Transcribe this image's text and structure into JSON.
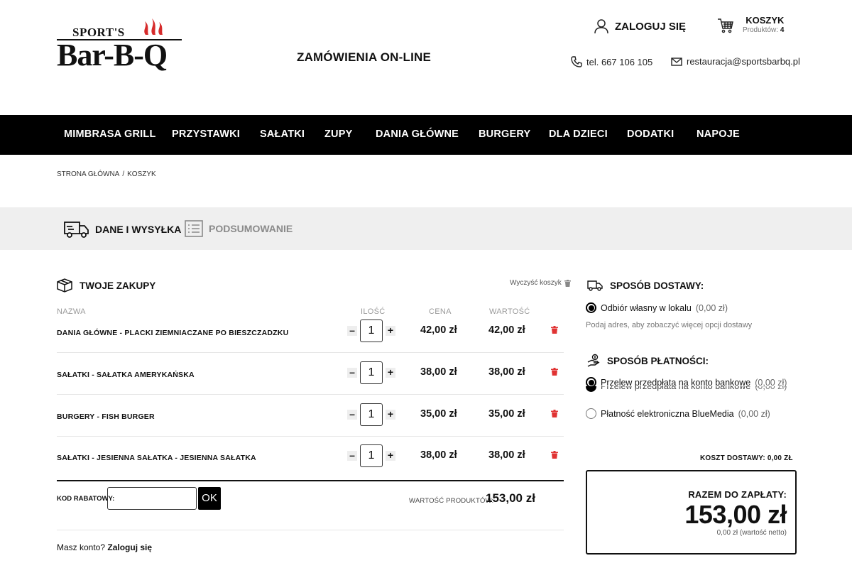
{
  "brand": {
    "logo_small": "SPORT'S",
    "logo_main": "Bar-B-Q",
    "flame_color": "#d62b2b"
  },
  "header": {
    "tagline": "ZAMÓWIENIA ON-LINE",
    "login_label": "ZALOGUJ SIĘ",
    "cart_title": "KOSZYK",
    "cart_count_label": "Produktów:",
    "cart_count": "4",
    "phone": "tel. 667 106 105",
    "email": "restauracja@sportsbarbq.pl"
  },
  "nav": {
    "items": [
      "MIMBRASA GRILL",
      "PRZYSTAWKI",
      "SAŁATKI",
      "ZUPY",
      "DANIA GŁÓWNE",
      "BURGERY",
      "DLA DZIECI",
      "DODATKI",
      "NAPOJE"
    ]
  },
  "breadcrumb": {
    "home": "STRONA GŁÓWNA",
    "separator": "/",
    "current": "KOSZYK"
  },
  "steps": {
    "step1": "DANE I WYSYŁKA",
    "step2": "PODSUMOWANIE"
  },
  "cart": {
    "title": "TWOJE ZAKUPY",
    "clear_label": "Wyczyść koszyk",
    "columns": {
      "name": "NAZWA",
      "qty": "ILOŚĆ",
      "price": "CENA",
      "value": "WARTOŚĆ"
    },
    "items": [
      {
        "name": "DANIA GŁÓWNE - PLACKI ZIEMNIACZANE PO BIESZCZADZKU",
        "qty": "1",
        "price": "42,00 zł",
        "value": "42,00 zł"
      },
      {
        "name": "SAŁATKI - SAŁATKA AMERYKAŃSKA",
        "qty": "1",
        "price": "38,00 zł",
        "value": "38,00 zł"
      },
      {
        "name": "BURGERY - FISH BURGER",
        "qty": "1",
        "price": "35,00 zł",
        "value": "35,00 zł"
      },
      {
        "name": "SAŁATKI - JESIENNA SAŁATKA - JESIENNA SAŁATKA",
        "qty": "1",
        "price": "38,00 zł",
        "value": "38,00 zł"
      }
    ],
    "minus": "–",
    "plus": "+",
    "coupon_label": "KOD RABATOWY:",
    "coupon_button": "OK",
    "subtotal_label": "WARTOŚĆ PRODUKTÓW:",
    "subtotal_value": "153,00 zł",
    "account_question": "Masz konto?",
    "account_link": "Zaloguj się"
  },
  "delivery": {
    "title": "SPOSÓB DOSTAWY:",
    "option_label": "Odbiór własny w lokalu",
    "option_price": "(0,00 zł)",
    "hint": "Podaj adres, aby zobaczyć więcej opcji dostawy"
  },
  "payment": {
    "title": "SPOSÓB PŁATNOŚCI:",
    "options": [
      {
        "label": "Przelew przedpłata na konto bankowe",
        "price": "(0,00 zł)"
      },
      {
        "label": "Płatność elektroniczna BlueMedia",
        "price": "(0,00 zł)"
      }
    ]
  },
  "summary": {
    "shipping_cost": "KOSZT DOSTAWY: 0,00 ZŁ",
    "total_label": "RAZEM DO ZAPŁATY:",
    "total_value": "153,00 zł",
    "total_net": "0,00 zł (wartość netto)"
  },
  "colors": {
    "nav_bg": "#000000",
    "steps_bg": "#efefef",
    "trash": "#e03333"
  }
}
